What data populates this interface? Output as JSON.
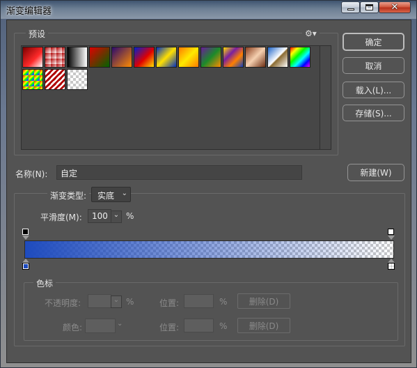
{
  "window": {
    "title": "渐变编辑器",
    "minimize_icon": "minimize-icon",
    "maximize_icon": "maximize-icon",
    "close_icon": "close-icon"
  },
  "presets": {
    "legend": "预设",
    "gear_icon": "gear-icon",
    "gear_glyph": "⚙▾",
    "swatches": [
      {
        "name": "foreground-to-background",
        "bg": "linear-gradient(135deg,#7a0000,#ff2a2a 60%,#ffffff)"
      },
      {
        "name": "foreground-to-transparent",
        "bg": "linear-gradient(135deg,#b00000,rgba(176,0,0,0))"
      },
      {
        "name": "black-white",
        "bg": "linear-gradient(90deg,#000,#fff)"
      },
      {
        "name": "red-green",
        "bg": "linear-gradient(135deg,#e00000,#006400)"
      },
      {
        "name": "violet-orange",
        "bg": "linear-gradient(135deg,#2b0a6e,#ff8c00)"
      },
      {
        "name": "blue-red-yellow",
        "bg": "linear-gradient(135deg,#0020d0,#e00000 55%,#ffe000)"
      },
      {
        "name": "blue-yellow-blue",
        "bg": "linear-gradient(135deg,#0030c0,#ffe000 50%,#0030c0)"
      },
      {
        "name": "orange-yellow-orange",
        "bg": "linear-gradient(135deg,#ff7a00,#ffea00 50%,#ff7a00)"
      },
      {
        "name": "violet-green-orange",
        "bg": "linear-gradient(135deg,#6a1b9a,#1b8a2a 50%,#ff8c00)"
      },
      {
        "name": "yellow-violet-orange-blue",
        "bg": "linear-gradient(135deg,#ffe000,#7a1fa0 35%,#ff8000 65%,#1040c0)"
      },
      {
        "name": "copper",
        "bg": "linear-gradient(135deg,#8a3e1e,#f5d0b0 50%,#6b2d12)"
      },
      {
        "name": "chrome",
        "bg": "linear-gradient(135deg,#1e64c8,#ffffff 50%,#8a6a30 55%,#ffffff)"
      },
      {
        "name": "spectrum",
        "bg": "linear-gradient(135deg,#ff0000,#ffff00,#00ff00,#00ffff,#0000ff,#ff00ff)"
      },
      {
        "name": "transparent-rainbow",
        "bg": "linear-gradient(135deg,#ff0000,#ff8800,#ffff00,#00ff00,#0066ff,#aa00ff)"
      },
      {
        "name": "transparent-stripes",
        "bg": "repeating-linear-gradient(135deg,#b00000 0 3px,#ffffff 3px 6px)"
      },
      {
        "name": "neutral-density",
        "bg": "checker"
      }
    ]
  },
  "buttons": {
    "ok": "确定",
    "cancel": "取消",
    "load": "载入(L)...",
    "save": "存储(S)...",
    "new": "新建(W)"
  },
  "name_field": {
    "label": "名称(N):",
    "value": "自定"
  },
  "gradient_type": {
    "label": "渐变类型:",
    "value": "实底",
    "arrow_glyph": "⌄"
  },
  "smoothness": {
    "label": "平滑度(M):",
    "value": "100",
    "unit": "%",
    "arrow_glyph": "⌄"
  },
  "gradient": {
    "start_color": "#1e4bbe",
    "opacity_start": 1,
    "opacity_end": 0
  },
  "color_stops": {
    "legend": "色标",
    "opacity_label": "不透明度:",
    "opacity_value": "",
    "opacity_unit": "%",
    "opacity_location_label": "位置:",
    "opacity_location_value": "",
    "opacity_location_unit": "%",
    "opacity_delete": "删除(D)",
    "color_label": "颜色:",
    "color_location_label": "位置:",
    "color_location_value": "",
    "color_location_unit": "%",
    "color_delete": "删除(D)",
    "arrow_glyph": "⌄"
  }
}
